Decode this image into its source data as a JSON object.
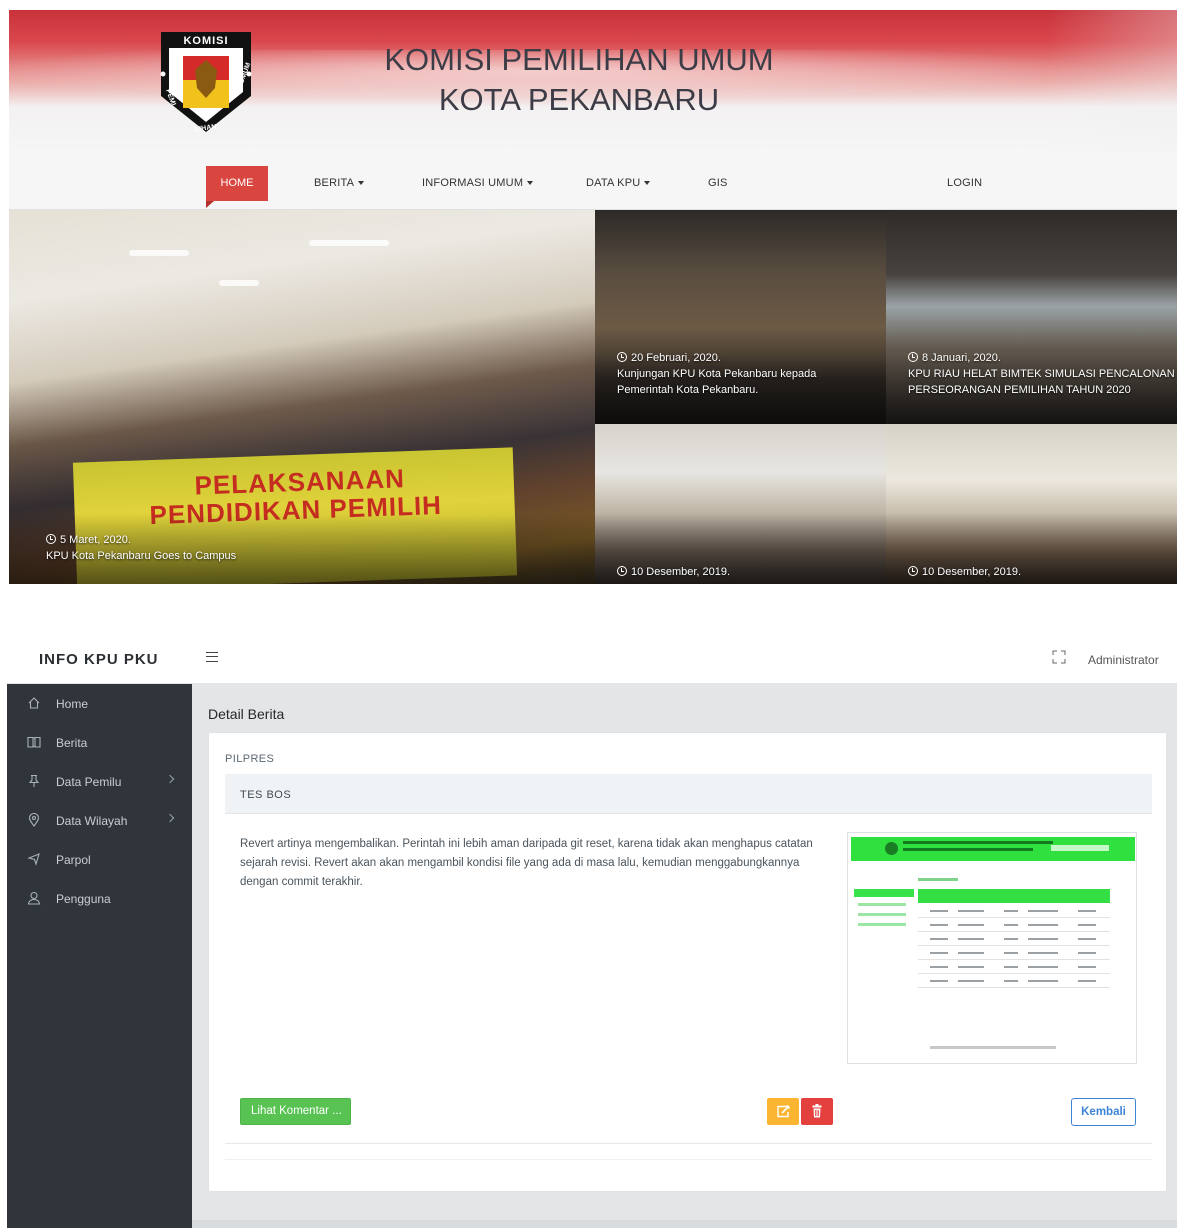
{
  "site": {
    "title_line1": "KOMISI PEMILIHAN UMUM",
    "title_line2": "KOTA PEKANBARU",
    "logo": {
      "top_text": "KOMISI",
      "left_text": "PEMI",
      "bottom_text": "LIHAN",
      "right_text": "UMUM",
      "icon": "garuda-emblem-icon"
    },
    "nav": {
      "home": "HOME",
      "berita": "BERITA",
      "informasi": "INFORMASI UMUM",
      "data_kpu": "DATA KPU",
      "gis": "GIS",
      "login": "LOGIN"
    },
    "posts": [
      {
        "date": "5 Maret, 2020.",
        "title": "KPU Kota Pekanbaru Goes to Campus"
      },
      {
        "date": "20 Februari, 2020.",
        "title_1": "Kunjungan KPU Kota Pekanbaru kepada",
        "title_2": "Pemerintah Kota Pekanbaru."
      },
      {
        "date": "8 Januari, 2020.",
        "title_1": "KPU RIAU HELAT BIMTEK SIMULASI PENCALONAN",
        "title_2": "PERSEORANGAN PEMILIHAN TAHUN 2020"
      },
      {
        "date": "10 Desember, 2019."
      },
      {
        "date": "10 Desember, 2019."
      }
    ],
    "banner_text_1": "PELAKSANAAN",
    "banner_text_2": "PENDIDIKAN PEMILIH"
  },
  "admin": {
    "brand": "INFO KPU PKU",
    "user": "Administrator",
    "sidebar": [
      {
        "label": "Home",
        "icon": "home-icon"
      },
      {
        "label": "Berita",
        "icon": "book-icon"
      },
      {
        "label": "Data Pemilu",
        "icon": "pin-icon",
        "has_children": true
      },
      {
        "label": "Data Wilayah",
        "icon": "location-icon",
        "has_children": true
      },
      {
        "label": "Parpol",
        "icon": "flag-icon"
      },
      {
        "label": "Pengguna",
        "icon": "user-icon"
      }
    ],
    "page_title": "Detail Berita",
    "news": {
      "category": "PILPRES",
      "title": "TES BOS",
      "body": "Revert artinya mengembalikan. Perintah ini lebih aman daripada git reset, karena tidak akan menghapus catatan sejarah revisi. Revert akan akan mengambil kondisi file yang ada di masa lalu, kemudian menggabungkannya dengan commit terakhir."
    },
    "buttons": {
      "komentar": "Lihat Komentar ...",
      "kembali": "Kembali",
      "edit_icon": "edit-icon",
      "delete_icon": "trash-icon"
    },
    "colors": {
      "sidebar": "#2f353a",
      "success": "#58c352",
      "warning": "#fbb531",
      "danger": "#e4413e",
      "primary": "#3d84d8",
      "site_accent": "#d9453f"
    }
  }
}
